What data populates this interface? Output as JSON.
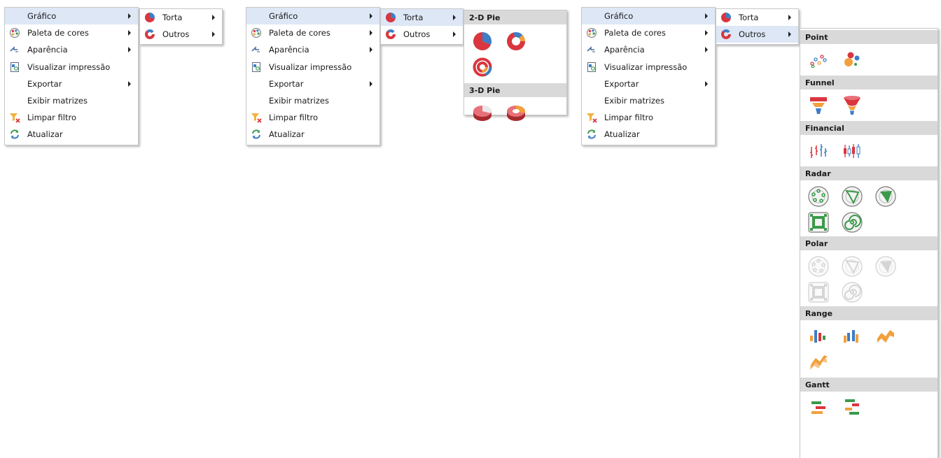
{
  "context_menu": {
    "items": [
      {
        "label": "Gráfico",
        "icon": "none",
        "has_submenu": true
      },
      {
        "label": "Paleta de cores",
        "icon": "palette-icon",
        "has_submenu": true
      },
      {
        "label": "Aparência",
        "icon": "appearance-icon",
        "has_submenu": true
      },
      {
        "label": "Visualizar impressão",
        "icon": "print-preview-icon",
        "has_submenu": false
      },
      {
        "label": "Exportar",
        "icon": "none",
        "has_submenu": true
      },
      {
        "label": "Exibir matrizes",
        "icon": "none",
        "has_submenu": false
      },
      {
        "label": "Limpar filtro",
        "icon": "clear-filter-icon",
        "has_submenu": false
      },
      {
        "label": "Atualizar",
        "icon": "refresh-icon",
        "has_submenu": false
      }
    ]
  },
  "chart_submenu": {
    "items": [
      {
        "label": "Torta",
        "icon": "pie-chart-icon",
        "has_submenu": true
      },
      {
        "label": "Outros",
        "icon": "donut-chart-icon",
        "has_submenu": true
      }
    ]
  },
  "pie_gallery": {
    "groups": [
      {
        "title": "2-D Pie",
        "items": [
          "pie-2d-icon",
          "doughnut-2d-icon",
          "nested-doughnut-icon"
        ]
      },
      {
        "title": "3-D Pie",
        "items": [
          "pie-3d-icon",
          "doughnut-3d-icon"
        ]
      }
    ]
  },
  "other_gallery": {
    "groups": [
      {
        "title": "Point",
        "items": [
          "point-icon",
          "bubble-icon"
        ]
      },
      {
        "title": "Funnel",
        "items": [
          "funnel-icon",
          "funnel-3d-icon"
        ]
      },
      {
        "title": "Financial",
        "items": [
          "stock-icon",
          "candlestick-icon"
        ]
      },
      {
        "title": "Radar",
        "items": [
          "radar-point-icon",
          "radar-line-icon",
          "radar-area-icon",
          "radar-square-icon",
          "radar-spiral-icon"
        ]
      },
      {
        "title": "Polar",
        "items": [
          "polar-point-icon",
          "polar-line-icon",
          "polar-area-icon",
          "polar-square-icon",
          "polar-spiral-icon"
        ]
      },
      {
        "title": "Range",
        "items": [
          "range-bar-icon",
          "side-by-side-range-bar-icon",
          "range-area-icon",
          "range-area-3d-icon"
        ]
      },
      {
        "title": "Gantt",
        "items": [
          "gantt-icon",
          "side-by-side-gantt-icon"
        ]
      }
    ]
  },
  "colors": {
    "selected_bg": "#dde7f6",
    "gallery_header_bg": "#d9d9d9",
    "red": "#d9363e",
    "blue": "#3d7ec6",
    "orange": "#f2a03d",
    "green": "#3b9a4b"
  }
}
